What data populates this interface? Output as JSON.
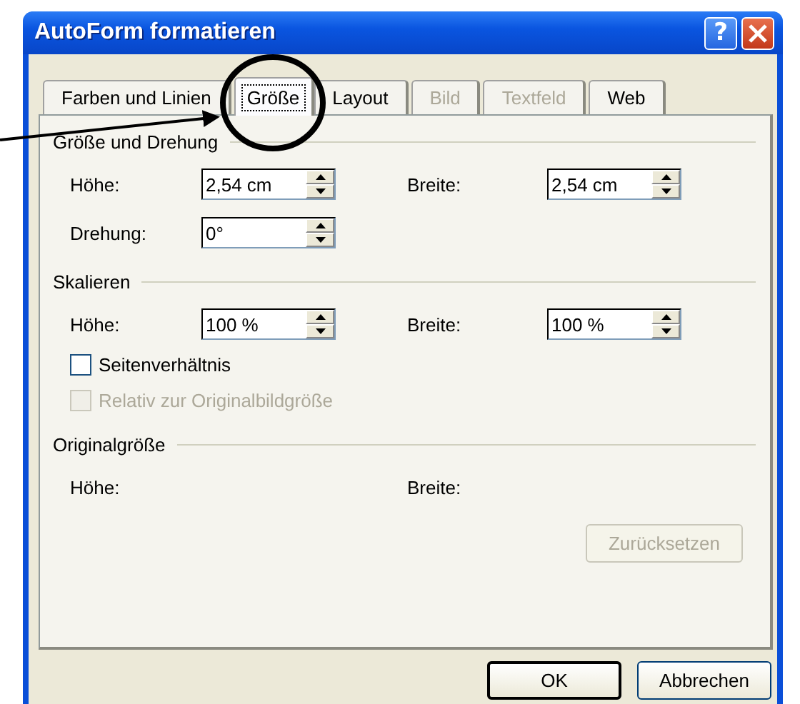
{
  "window": {
    "title": "AutoForm formatieren",
    "help": "?"
  },
  "tabs": [
    {
      "label": "Farben und Linien",
      "selected": false,
      "disabled": false
    },
    {
      "label": "Größe",
      "selected": true,
      "disabled": false
    },
    {
      "label": "Layout",
      "selected": false,
      "disabled": false
    },
    {
      "label": "Bild",
      "selected": false,
      "disabled": true
    },
    {
      "label": "Textfeld",
      "selected": false,
      "disabled": true
    },
    {
      "label": "Web",
      "selected": false,
      "disabled": false
    }
  ],
  "sections": [
    {
      "title": "Größe und Drehung",
      "items": [
        {
          "kind": "fields",
          "fields": [
            {
              "label": "Höhe:",
              "value": "2,54 cm"
            },
            {
              "label": "Breite:",
              "value": "2,54 cm"
            }
          ]
        },
        {
          "kind": "fields",
          "fields": [
            {
              "label": "Drehung:",
              "value": "0°"
            }
          ]
        }
      ]
    },
    {
      "title": "Skalieren",
      "items": [
        {
          "kind": "fields",
          "fields": [
            {
              "label": "Höhe:",
              "value": "100 %"
            },
            {
              "label": "Breite:",
              "value": "100 %"
            }
          ]
        },
        {
          "kind": "checkbox",
          "label": "Seitenverhältnis",
          "checked": false,
          "disabled": false
        },
        {
          "kind": "checkbox",
          "label": "Relativ zur Originalbildgröße",
          "checked": false,
          "disabled": true
        }
      ]
    },
    {
      "title": "Originalgröße",
      "items": [
        {
          "kind": "static",
          "fields": [
            {
              "label": "Höhe:"
            },
            {
              "label": "Breite:"
            }
          ]
        }
      ]
    }
  ],
  "reset_button": {
    "label": "Zurücksetzen",
    "disabled": true
  },
  "buttons": [
    {
      "label": "OK",
      "default": true
    },
    {
      "label": "Abbrechen",
      "default": false
    }
  ]
}
